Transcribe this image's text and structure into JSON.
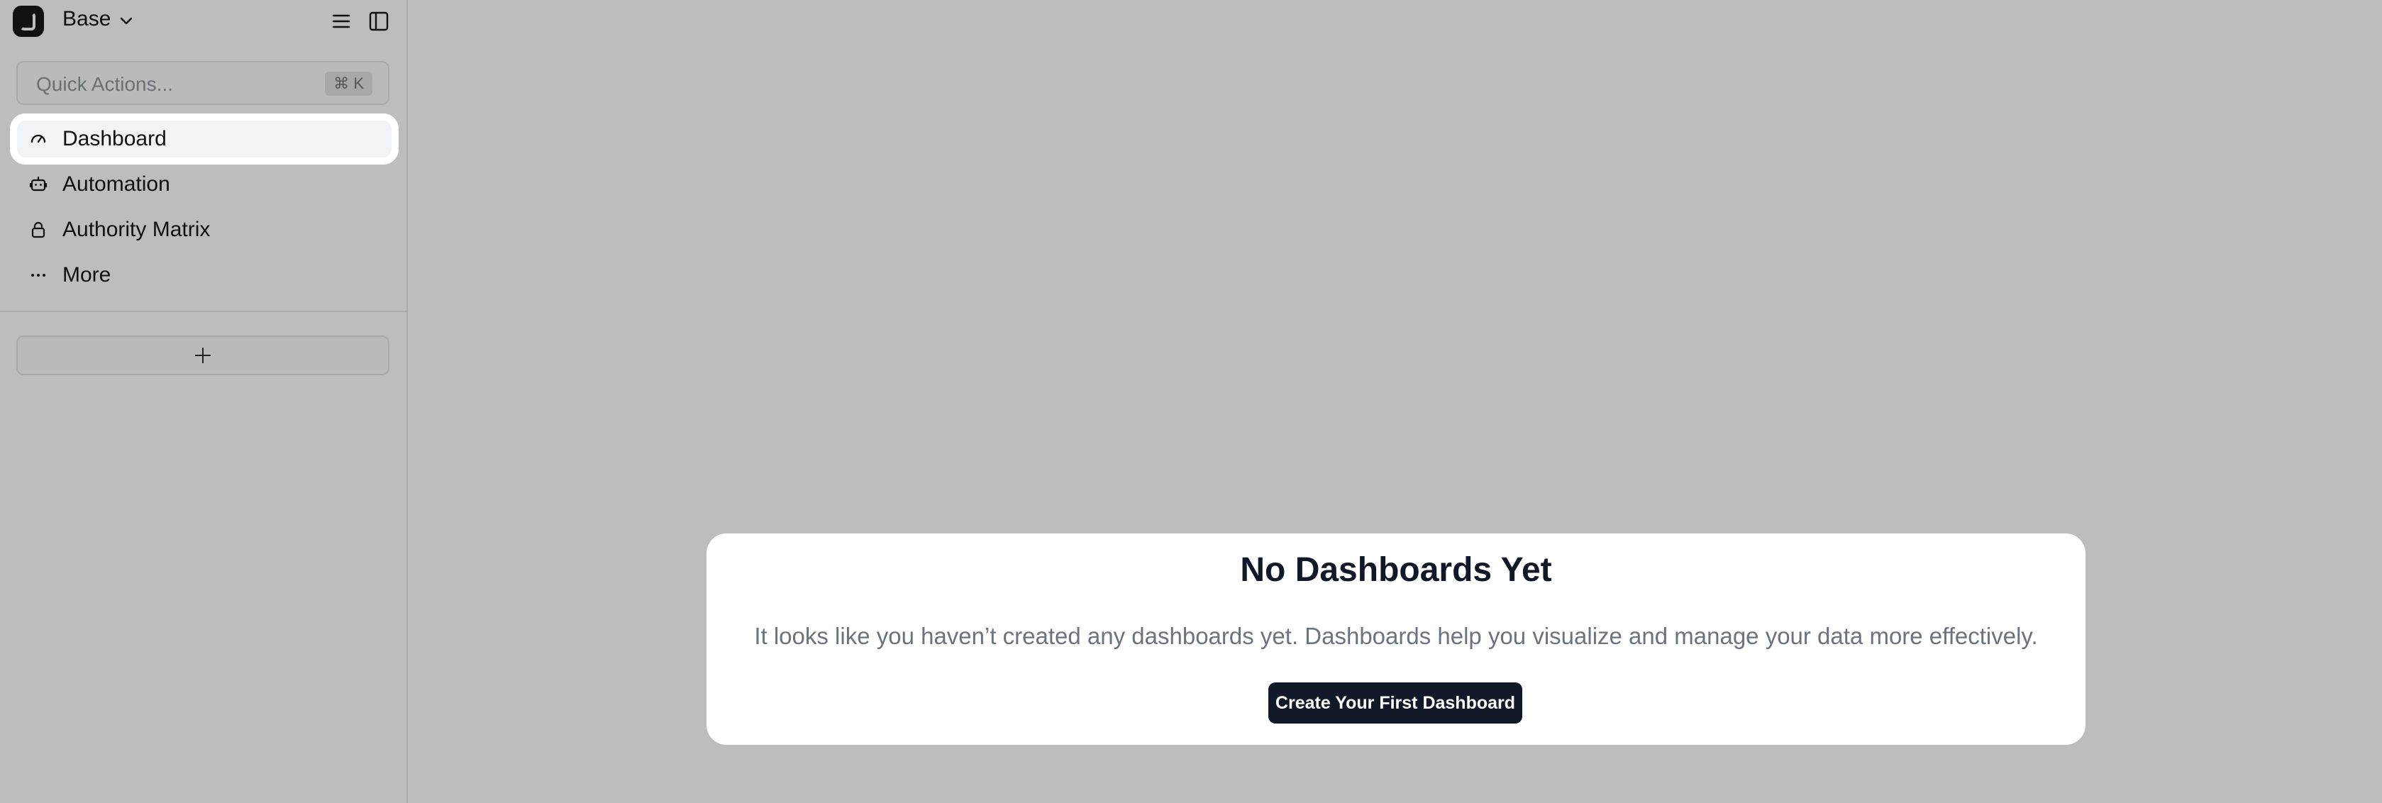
{
  "topbar": {
    "workspace_name": "Base"
  },
  "quick_actions": {
    "placeholder": "Quick Actions...",
    "shortcut": "⌘ K"
  },
  "sidebar": {
    "items": [
      {
        "label": "Dashboard",
        "icon": "gauge-icon",
        "active": true
      },
      {
        "label": "Automation",
        "icon": "robot-icon",
        "active": false
      },
      {
        "label": "Authority Matrix",
        "icon": "lock-icon",
        "active": false
      },
      {
        "label": "More",
        "icon": "more-horizontal-icon",
        "active": false
      }
    ]
  },
  "empty_state": {
    "title": "No Dashboards Yet",
    "description": "It looks like you haven’t created any dashboards yet. Dashboards help you visualize and manage your data more effectively.",
    "button_label": "Create Your First Dashboard"
  },
  "colors": {
    "overlay": "#bdbdbd",
    "card": "#ffffff",
    "primary_button": "#111827",
    "text_muted": "#6b7280"
  }
}
